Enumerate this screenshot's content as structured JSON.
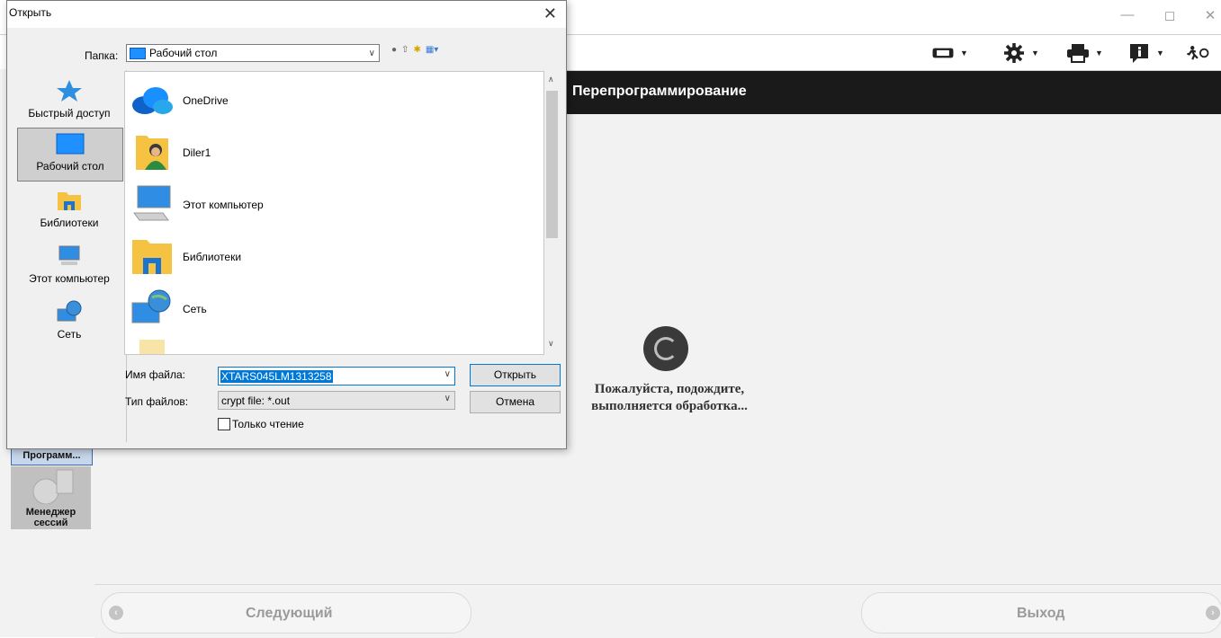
{
  "app": {
    "window_controls": {
      "minimize": "—",
      "maximize": "◻",
      "close": "✕"
    },
    "header_title": "Перепрограммирование",
    "wait_message_line1": "Пожалуйста, подождите,",
    "wait_message_line2": "выполняется обработка...",
    "side_panel": [
      {
        "label": "Программ...",
        "selected": true
      },
      {
        "label_line1": "Менеджер",
        "label_line2": "сессий",
        "selected": false
      }
    ],
    "bottom": {
      "next_label": "Следующий",
      "exit_label": "Выход"
    },
    "toolbar_icons": [
      "vehicle-icon",
      "settings-gear-icon",
      "printer-icon",
      "info-icon",
      "exit-run-icon"
    ],
    "colors": {
      "header_bg": "#1a1a1a",
      "panel_bg": "#f2f2f2",
      "accent": "#0078d7"
    }
  },
  "dialog": {
    "title": "Открыть",
    "close": "✕",
    "folder_label": "Папка:",
    "folder_value": "Рабочий стол",
    "places": [
      {
        "label": "Быстрый доступ",
        "icon": "quick-access-star-icon"
      },
      {
        "label": "Рабочий стол",
        "icon": "desktop-icon",
        "selected": true
      },
      {
        "label": "Библиотеки",
        "icon": "libraries-icon"
      },
      {
        "label": "Этот компьютер",
        "icon": "this-pc-icon"
      },
      {
        "label": "Сеть",
        "icon": "network-icon"
      }
    ],
    "files": [
      {
        "name": "OneDrive",
        "icon": "onedrive-cloud-icon"
      },
      {
        "name": "Diler1",
        "icon": "user-folder-icon"
      },
      {
        "name": "Этот компьютер",
        "icon": "computer-icon"
      },
      {
        "name": "Библиотеки",
        "icon": "libraries-folder-icon"
      },
      {
        "name": "Сеть",
        "icon": "network-globe-icon"
      }
    ],
    "filename_label": "Имя файла:",
    "filename_value": "XTARS045LM1313258",
    "filetype_label": "Тип файлов:",
    "filetype_value": "crypt file: *.out",
    "open_button": "Открыть",
    "cancel_button": "Отмена",
    "readonly_label": "Только чтение"
  }
}
